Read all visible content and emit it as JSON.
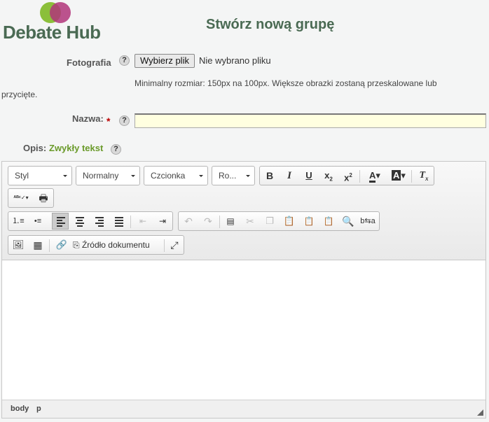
{
  "logo": {
    "text": "Debate Hub"
  },
  "page_title": "Stwórz nową grupę",
  "photo": {
    "label": "Fotografia",
    "button_label": "Wybierz plik",
    "status": "Nie wybrano pliku",
    "hint_line1": "Minimalny rozmiar: 150px na 100px. Większe obrazki zostaną przeskalowane lub",
    "hint_line2": "przycięte."
  },
  "name": {
    "label": "Nazwa:",
    "required_mark": "*",
    "value": ""
  },
  "description": {
    "label": "Opis:",
    "plain_text_link": "Zwykły tekst"
  },
  "help_glyph": "?",
  "editor": {
    "combos": {
      "style": "Styl",
      "format": "Normalny",
      "font": "Czcionka",
      "size": "Ro..."
    },
    "source_label": "Źródło dokumentu",
    "path": [
      "body",
      "p"
    ]
  },
  "colors": {
    "brand_green": "#4a6a53",
    "link_green": "#6a9a2a",
    "required_red": "#b00000",
    "input_yellow": "#ffffe0"
  }
}
